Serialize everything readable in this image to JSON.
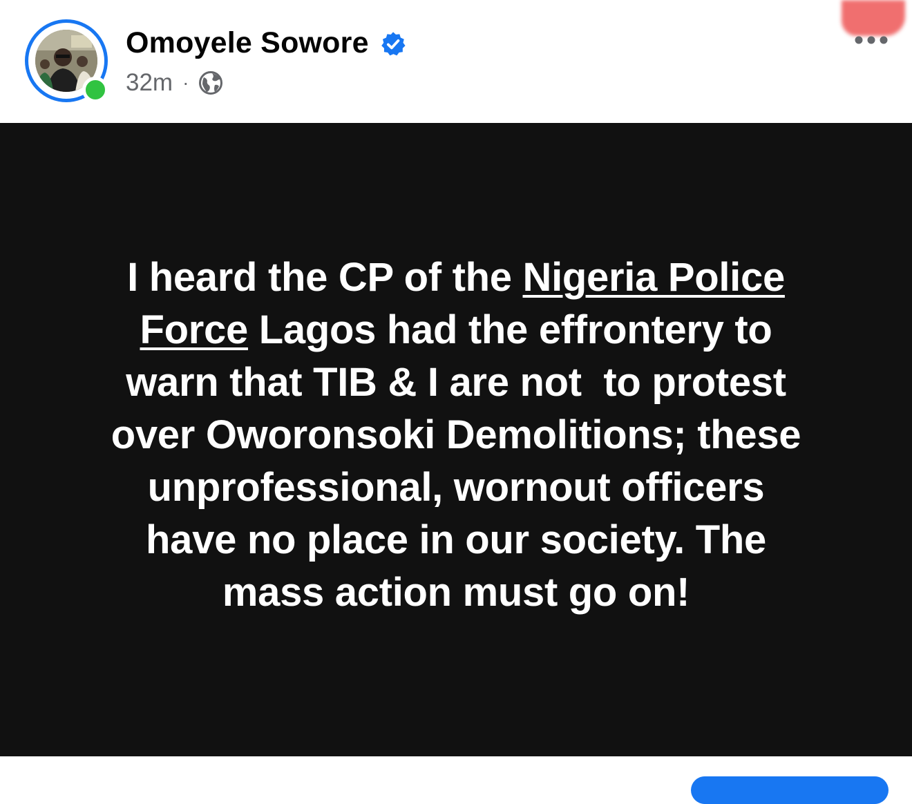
{
  "post": {
    "author": "Omoyele Sowore",
    "verified": true,
    "time": "32m",
    "separator": "·",
    "audience_icon": "globe-icon",
    "more_icon": "more-options-icon",
    "text_lines": [
      {
        "before": "I heard the CP of the ",
        "link": "Nigeria Police",
        "after": ""
      },
      {
        "before": "",
        "link": "Force",
        "after": " Lagos had the effrontery to"
      },
      {
        "before": "warn that TIB & I are not  to protest",
        "link": "",
        "after": ""
      },
      {
        "before": "over Oworonsoki Demolitions; these",
        "link": "",
        "after": ""
      },
      {
        "before": "unprofessional, wornout officers",
        "link": "",
        "after": ""
      },
      {
        "before": "have no place in our society. The",
        "link": "",
        "after": ""
      },
      {
        "before": "mass action must go on!",
        "link": "",
        "after": ""
      }
    ]
  },
  "colors": {
    "accent": "#1877f2",
    "online": "#31c341",
    "card_background": "#111111",
    "meta_text": "#65676b"
  }
}
